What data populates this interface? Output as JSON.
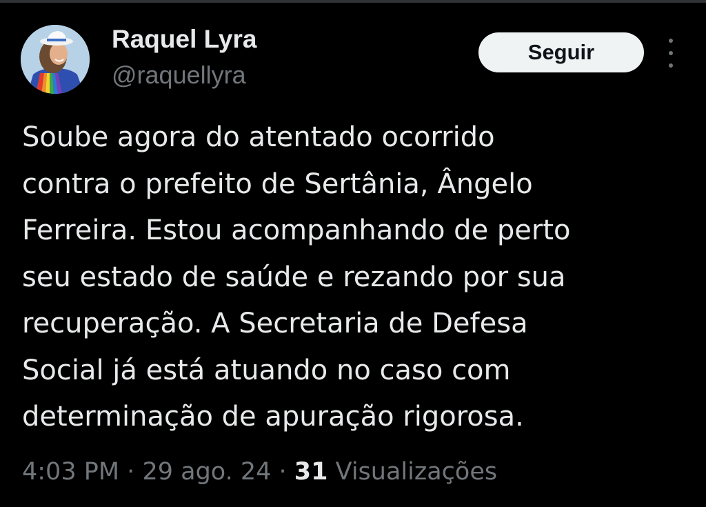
{
  "tweet": {
    "author": {
      "display_name": "Raquel Lyra",
      "handle": "@raquellyra",
      "avatar_icon": "profile-photo"
    },
    "follow_label": "Seguir",
    "more_icon": "more-options-icon",
    "text_lines": [
      "Soube agora do atentado ocorrido",
      "contra o prefeito de Sertânia, Ângelo",
      "Ferreira. Estou acompanhando de perto",
      "seu estado de saúde e rezando por sua",
      "recuperação. A Secretaria de Defesa",
      "Social já está atuando no caso com",
      "determinação de apuração rigorosa."
    ],
    "meta": {
      "time": "4:03 PM",
      "separator": "·",
      "date": "29 ago. 24",
      "views_count": "31",
      "views_label": "Visualizações"
    }
  },
  "colors": {
    "background": "#000000",
    "text_primary": "#e7e9ea",
    "text_secondary": "#71767b",
    "button_bg": "#eff3f4",
    "button_text": "#0f1419"
  }
}
